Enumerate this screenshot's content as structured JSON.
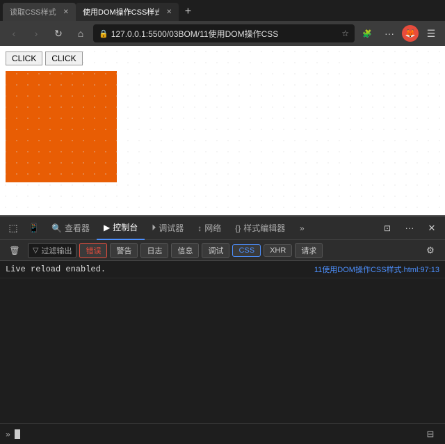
{
  "browser": {
    "tabs": [
      {
        "id": "tab1",
        "label": "读取CSS样式",
        "active": false
      },
      {
        "id": "tab2",
        "label": "使用DOM操作CSS样式",
        "active": true
      }
    ],
    "tab_new_label": "+",
    "nav": {
      "back_btn": "‹",
      "forward_btn": "›",
      "refresh_btn": "↻",
      "home_btn": "⌂",
      "url": "127.0.0.1:5500/03BOM/11使用DOM操作CSS",
      "more_btn": "···",
      "bookmark_btn": "☆",
      "reader_btn": "≡",
      "extensions_btn": "🧩",
      "menu_btn": "☰"
    }
  },
  "page": {
    "btn1_label": "CLICK",
    "btn2_label": "CLICK"
  },
  "devtools": {
    "tabs": [
      {
        "id": "inspector",
        "label": "查看器",
        "icon": "🔍"
      },
      {
        "id": "console",
        "label": "控制台",
        "icon": "▶",
        "active": true
      },
      {
        "id": "debugger",
        "label": "调试器",
        "icon": "⏵"
      },
      {
        "id": "network",
        "label": "网络",
        "icon": "↕"
      },
      {
        "id": "style",
        "label": "样式编辑器",
        "icon": "{}"
      }
    ],
    "more_btn": "»",
    "close_btn": "✕",
    "ellipsis_btn": "···",
    "undock_btn": "⊡",
    "filter_placeholder": "过滤输出",
    "filter_icon": "⊡",
    "console_buttons": [
      {
        "id": "error",
        "label": "错误"
      },
      {
        "id": "warning",
        "label": "警告"
      },
      {
        "id": "log",
        "label": "日志"
      },
      {
        "id": "info",
        "label": "信息"
      },
      {
        "id": "debug",
        "label": "调试"
      },
      {
        "id": "css",
        "label": "CSS",
        "active": true
      },
      {
        "id": "xhr",
        "label": "XHR"
      },
      {
        "id": "request",
        "label": "请求"
      }
    ],
    "settings_icon": "⚙",
    "log_message": "Live reload enabled.",
    "log_source": "11使用DOM操作CSS样式.html:97:13",
    "console_prompt": "»",
    "sidebar_btn": "⊟"
  }
}
